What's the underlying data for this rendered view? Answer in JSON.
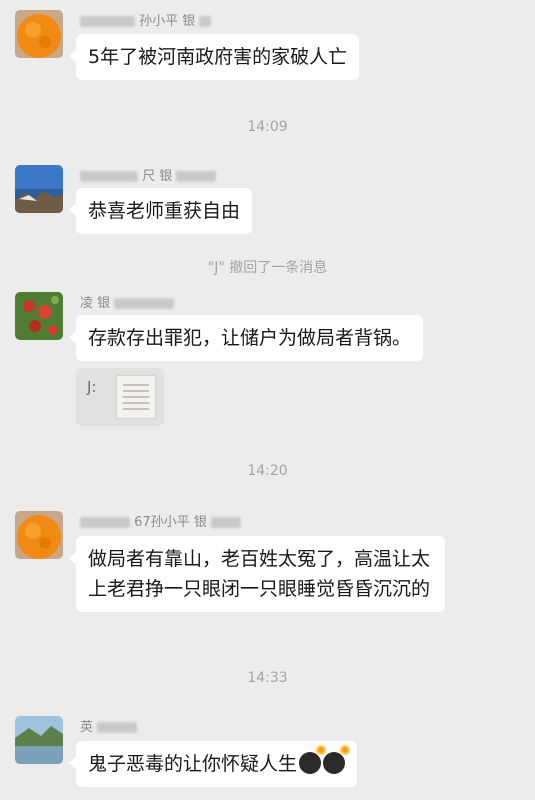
{
  "messages": [
    {
      "sender_visible": "孙小平 银",
      "text": "5年了被河南政府害的家破人亡"
    },
    {
      "sender_visible": "尺 银",
      "text": "恭喜老师重获自由"
    },
    {
      "sender_visible": "凌 银",
      "text": "存款存出罪犯，让储户为做局者背锅。",
      "quote_label": "J:"
    },
    {
      "sender_visible": "67孙小平 银",
      "text": "做局者有靠山，老百姓太冤了，高温让太上老君挣一只眼闭一只眼睡觉昏昏沉沉的"
    },
    {
      "sender_visible": "英",
      "text": "鬼子恶毒的让你怀疑人生"
    }
  ],
  "timestamps": [
    "14:09",
    "14:20",
    "14:33"
  ],
  "system_notes": [
    "\"J\" 撤回了一条消息"
  ],
  "icons": {
    "avatar_1": "orange-fruit-avatar",
    "avatar_2": "seaside-rock-avatar",
    "avatar_3": "pomegranate-flower-avatar",
    "avatar_4": "orange-fruit-avatar",
    "avatar_5": "lake-landscape-avatar",
    "clover": "clover-icon",
    "bomb": "bomb-icon"
  },
  "colors": {
    "background": "#ececec",
    "bubble": "#ffffff",
    "meta_text": "#a3a3a3"
  }
}
